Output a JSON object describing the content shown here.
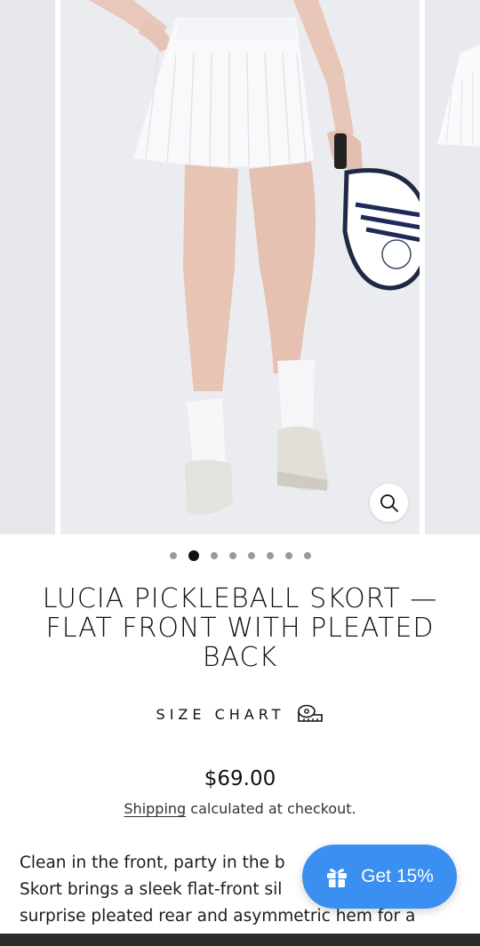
{
  "gallery": {
    "slide_count": 8,
    "active_index": 1,
    "zoom_icon": "magnifier-icon"
  },
  "product": {
    "title": "LUCIA PICKLEBALL SKORT — FLAT FRONT WITH PLEATED BACK",
    "size_chart_label": "SIZE CHART",
    "size_chart_icon": "measuring-tape-icon",
    "price": "$69.00",
    "shipping_link": "Shipping",
    "shipping_text": " calculated at checkout.",
    "description_lines": [
      "Clean in the front, party in the b",
      "Skort brings a sleek flat-front sil",
      "surprise pleated rear and asymmetric hem for a"
    ]
  },
  "promo": {
    "label": "Get 15%",
    "icon": "gift-icon",
    "color": "#3a8ff0"
  }
}
